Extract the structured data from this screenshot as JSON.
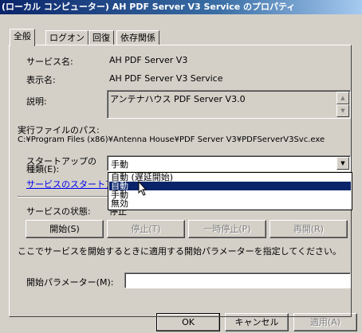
{
  "window": {
    "title": "(ローカル コンピューター) AH PDF Server V3 Service のプロパティ"
  },
  "tabs": [
    {
      "label": "全般"
    },
    {
      "label": "ログオン"
    },
    {
      "label": "回復"
    },
    {
      "label": "依存関係"
    }
  ],
  "general": {
    "service_name_label": "サービス名:",
    "service_name": "AH PDF Server V3",
    "display_name_label": "表示名:",
    "display_name": "AH PDF Server V3 Service",
    "description_label": "説明:",
    "description": "アンテナハウス PDF Server V3.0",
    "exe_path_label": "実行ファイルのパス:",
    "exe_path": "C:¥Program Files (x86)¥Antenna House¥PDF Server V3¥PDFServerV3Svc.exe",
    "startup_type_label_line1": "スタートアップの",
    "startup_type_label_line2": "種類(E):",
    "startup_type_value": "手動",
    "startup_options": [
      "自動 (遅延開始)",
      "自動",
      "手動",
      "無効"
    ],
    "startup_selected_index": 1,
    "startup_help_link": "サービスのスタートアップ",
    "status_label": "サービスの状態:",
    "status_value": "停止",
    "start_button": "開始(S)",
    "stop_button": "停止(T)",
    "pause_button": "一時停止(P)",
    "resume_button": "再開(R)",
    "params_hint": "ここでサービスを開始するときに適用する開始パラメーターを指定してください。",
    "start_params_label": "開始パラメーター(M):",
    "start_params_value": ""
  },
  "footer": {
    "ok": "OK",
    "cancel": "キャンセル",
    "apply": "適用(A)"
  }
}
